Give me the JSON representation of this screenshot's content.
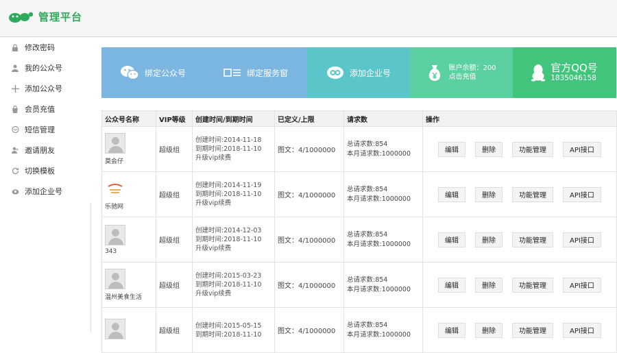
{
  "header": {
    "title": "管理平台",
    "logo_icon": "paw-logo-icon"
  },
  "sidebar": {
    "items": [
      {
        "label": "修改密码",
        "icon": "lock-icon"
      },
      {
        "label": "我的公众号",
        "icon": "user-icon"
      },
      {
        "label": "添加公众号",
        "icon": "plus-icon"
      },
      {
        "label": "会员充值",
        "icon": "bag-icon"
      },
      {
        "label": "短信管理",
        "icon": "envelope-icon"
      },
      {
        "label": "邀请朋友",
        "icon": "users-icon"
      },
      {
        "label": "切换模板",
        "icon": "refresh-icon"
      },
      {
        "label": "添加企业号",
        "icon": "cloud-icon"
      }
    ]
  },
  "tiles": {
    "bind_mp": {
      "label": "绑定公众号",
      "color": "#7ab6e0"
    },
    "bind_service": {
      "label": "绑定服务窗",
      "color": "#7ab6e0"
    },
    "add_enterprise": {
      "label": "添加企业号",
      "color": "#5bc6c9"
    },
    "balance": {
      "line1": "账户余额：200",
      "line2": "点击充值",
      "color": "#5bd0a0"
    },
    "qq": {
      "title": "官方QQ号",
      "number": "1835046158",
      "color": "#41c57c"
    }
  },
  "table": {
    "headers": [
      "公众号名称",
      "VIP等级",
      "创建时间/到期时间",
      "已定义/上限",
      "请求数",
      "操作"
    ],
    "rows": [
      {
        "name": "莫会仔",
        "vip": "超级组",
        "created": "创建时间:2014-11-18",
        "expires": "到期时间:2018-11-10",
        "upgrade": "升级vip续费",
        "usage": "图文：4/1000000",
        "total": "总请求数:854",
        "monthly": "本月请求数:1000000"
      },
      {
        "name": "乐驰网",
        "vip": "超级组",
        "created": "创建时间:2014-11-19",
        "expires": "到期时间:2018-11-10",
        "upgrade": "升级vip续费",
        "usage": "图文：4/1000000",
        "total": "总请求数:854",
        "monthly": "本月请求数:1000000"
      },
      {
        "name": "343",
        "vip": "超级组",
        "created": "创建时间:2014-12-03",
        "expires": "到期时间:2018-11-10",
        "upgrade": "升级vip续费",
        "usage": "图文：4/1000000",
        "total": "总请求数:854",
        "monthly": "本月请求数:1000000"
      },
      {
        "name": "温州美食生活",
        "vip": "超级组",
        "created": "创建时间:2015-03-23",
        "expires": "到期时间:2018-11-10",
        "upgrade": "升级vip续费",
        "usage": "图文：4/1000000",
        "total": "总请求数:854",
        "monthly": "本月请求数:1000000"
      },
      {
        "name": "",
        "vip": "超级组",
        "created": "创建时间:2015-05-15",
        "expires": "到期时间:2018-11-10",
        "upgrade": "",
        "usage": "图文：4/1000000",
        "total": "总请求数:854",
        "monthly": "本月请求数:1000000"
      }
    ],
    "actions": [
      "编辑",
      "删除",
      "功能管理",
      "API接口"
    ]
  }
}
